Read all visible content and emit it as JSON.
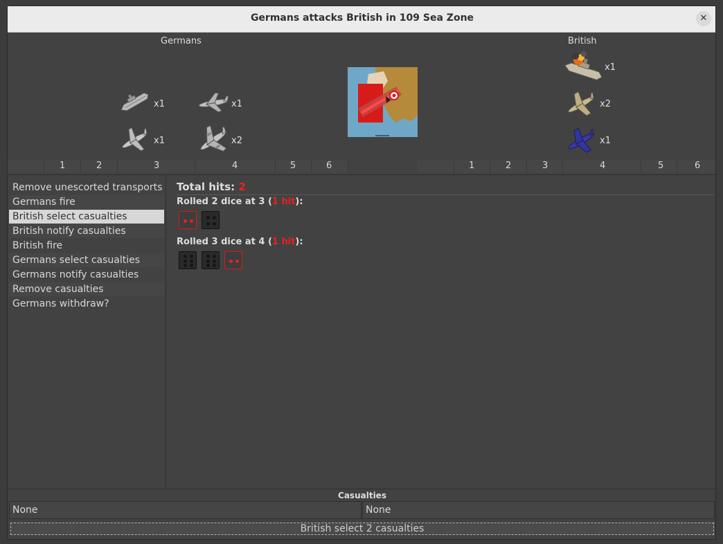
{
  "window": {
    "title": "Germans attacks British in 109 Sea Zone"
  },
  "sides": {
    "attacker": {
      "name": "Germans",
      "units": [
        {
          "icon": "destroyer-icon",
          "count": "x1"
        },
        {
          "icon": "fighter-plane-icon",
          "count": "x1"
        },
        {
          "icon": "tactical-bomber-icon",
          "count": "x1"
        },
        {
          "icon": "bomber-icon",
          "count": "x2"
        }
      ]
    },
    "defender": {
      "name": "British",
      "units": [
        {
          "icon": "damaged-battleship-icon",
          "count": "x1"
        },
        {
          "icon": "fighter-plane-icon",
          "count": "x2"
        },
        {
          "icon": "blue-fighter-plane-icon",
          "count": "x1"
        }
      ]
    }
  },
  "dice_columns": [
    "1",
    "2",
    "3",
    "4",
    "5",
    "6"
  ],
  "steps": [
    {
      "label": "Remove unescorted transports"
    },
    {
      "label": "Germans fire"
    },
    {
      "label": "British select casualties",
      "selected": true
    },
    {
      "label": "British notify casualties"
    },
    {
      "label": "British fire"
    },
    {
      "label": "Germans select casualties"
    },
    {
      "label": "Germans notify casualties"
    },
    {
      "label": "Remove casualties"
    },
    {
      "label": "Germans withdraw?"
    }
  ],
  "results": {
    "total_label": "Total hits:",
    "total_value": "2",
    "rolls": [
      {
        "prefix": "Rolled 2 dice at 3 (",
        "hits": "1 hit",
        "suffix": "):",
        "dice": [
          2,
          4
        ],
        "hit": [
          true,
          false
        ]
      },
      {
        "prefix": "Rolled 3 dice at 4 (",
        "hits": "1 hit",
        "suffix": "):",
        "dice": [
          6,
          6,
          2
        ],
        "hit": [
          false,
          false,
          true
        ]
      }
    ]
  },
  "casualties": {
    "header": "Casualties",
    "left": "None",
    "right": "None"
  },
  "status": {
    "text": "British select 2 casualties"
  },
  "colors": {
    "hit": "#ee2020",
    "panel": "#424242",
    "titlebar": "#ebebeb"
  }
}
